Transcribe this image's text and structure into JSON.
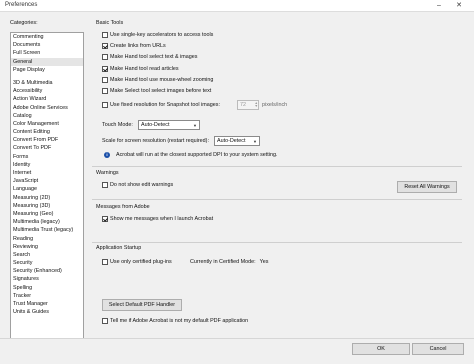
{
  "window": {
    "title": "Preferences"
  },
  "categories": {
    "label": "Categories:",
    "top_items": [
      "Commenting",
      "Documents",
      "Full Screen",
      "General",
      "Page Display"
    ],
    "items": [
      "3D & Multimedia",
      "Accessibility",
      "Action Wizard",
      "Adobe Online Services",
      "Catalog",
      "Color Management",
      "Content Editing",
      "Convert From PDF",
      "Convert To PDF",
      "Forms",
      "Identity",
      "Internet",
      "JavaScript",
      "Language",
      "Measuring (2D)",
      "Measuring (3D)",
      "Measuring (Geo)",
      "Multimedia (legacy)",
      "Multimedia Trust (legacy)",
      "Reading",
      "Reviewing",
      "Search",
      "Security",
      "Security (Enhanced)",
      "Signatures",
      "Spelling",
      "Tracker",
      "Trust Manager",
      "Units & Guides"
    ],
    "selected": "General"
  },
  "basic_tools": {
    "title": "Basic Tools",
    "single_key": "Use single-key accelerators to access tools",
    "create_links": "Create links from URLs",
    "hand_select": "Make Hand tool select text & images",
    "hand_read": "Make Hand tool read articles",
    "hand_wheel": "Make Hand tool use mouse-wheel zooming",
    "select_images": "Make Select tool select images before text",
    "fixed_resolution": "Use fixed resolution for Snapshot tool images:",
    "resolution_value": "72",
    "resolution_unit": "pixels/inch",
    "touch_mode_label": "Touch Mode:",
    "touch_mode_value": "Auto-Detect",
    "scale_label": "Scale for screen resolution (restart required):",
    "scale_value": "Auto-Detect",
    "info_text": "Acrobat will run at the closest supported DPI to your system setting."
  },
  "warnings": {
    "title": "Warnings",
    "dont_show": "Do not show edit warnings",
    "reset_button": "Reset All Warnings"
  },
  "messages": {
    "title": "Messages from Adobe",
    "show_messages": "Show me messages when I launch Acrobat"
  },
  "app_startup": {
    "title": "Application Startup",
    "certified_plugins": "Use only certified plug-ins",
    "certified_mode_label": "Currently in Certified Mode:",
    "certified_mode_value": "Yes",
    "default_pdf_button": "Select Default PDF Handler",
    "tell_me": "Tell me if Adobe Acrobat is not my default PDF application"
  },
  "footer": {
    "ok": "OK",
    "cancel": "Cancel"
  }
}
